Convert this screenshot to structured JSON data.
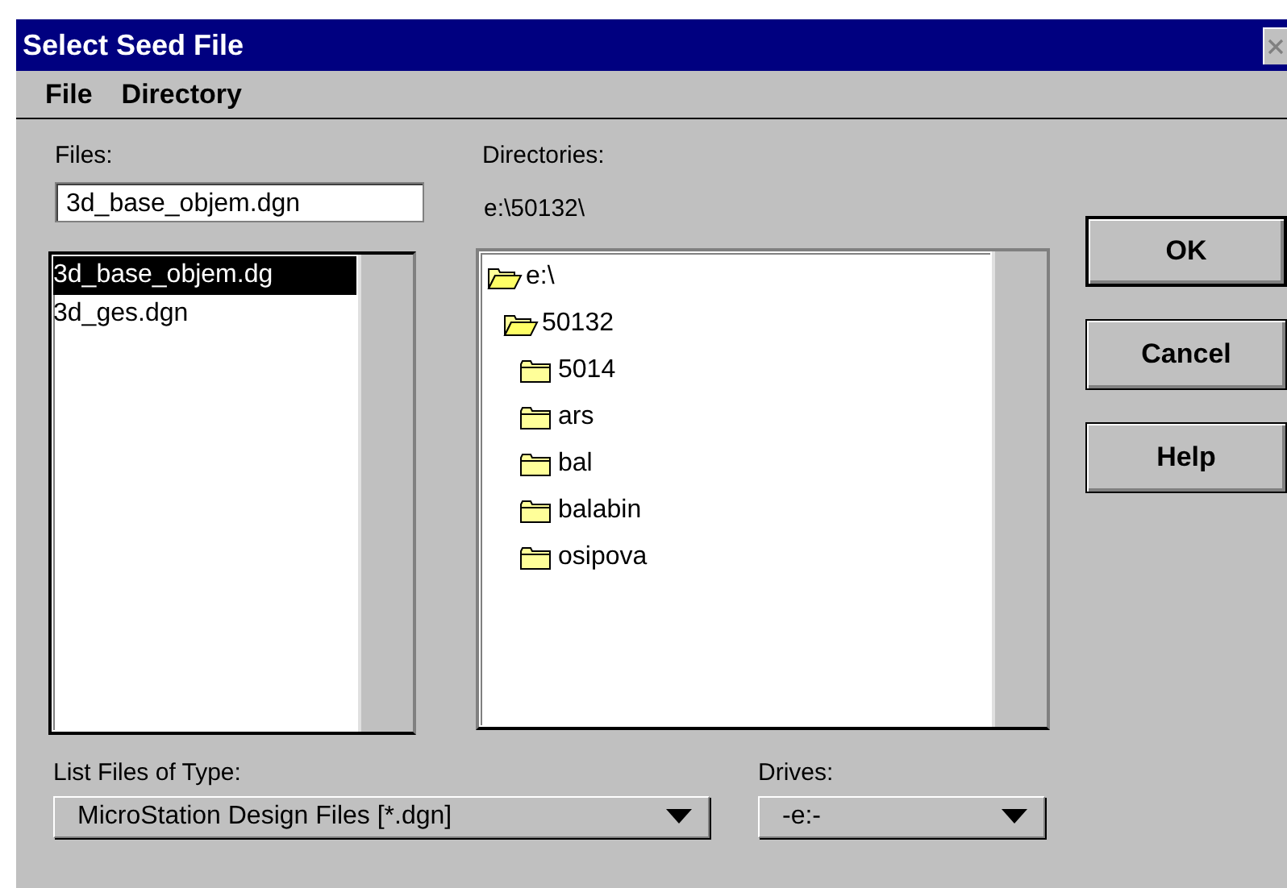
{
  "window": {
    "title": "Select Seed File"
  },
  "menu": [
    "File",
    "Directory"
  ],
  "files": {
    "label": "Files:",
    "value": "3d_base_objem.dgn",
    "items": [
      {
        "name": "3d_base_objem.dg",
        "selected": true
      },
      {
        "name": "3d_ges.dgn",
        "selected": false
      }
    ]
  },
  "directories": {
    "label": "Directories:",
    "path": "e:\\50132\\",
    "tree": [
      {
        "name": "e:\\",
        "expanded": true,
        "children": [
          {
            "name": "50132",
            "expanded": true,
            "children": [
              {
                "name": "5014",
                "expanded": false
              },
              {
                "name": "ars",
                "expanded": false
              },
              {
                "name": "bal",
                "expanded": false
              },
              {
                "name": "balabin",
                "expanded": false
              },
              {
                "name": "osipova",
                "expanded": false
              }
            ]
          }
        ]
      }
    ]
  },
  "buttons": [
    {
      "label": "OK",
      "default": true
    },
    {
      "label": "Cancel",
      "default": false
    },
    {
      "label": "Help",
      "default": false
    }
  ],
  "file_type": {
    "label": "List Files of Type:",
    "value": "MicroStation Design Files [*.dgn]"
  },
  "drives": {
    "label": "Drives:",
    "value": "-e:-"
  }
}
